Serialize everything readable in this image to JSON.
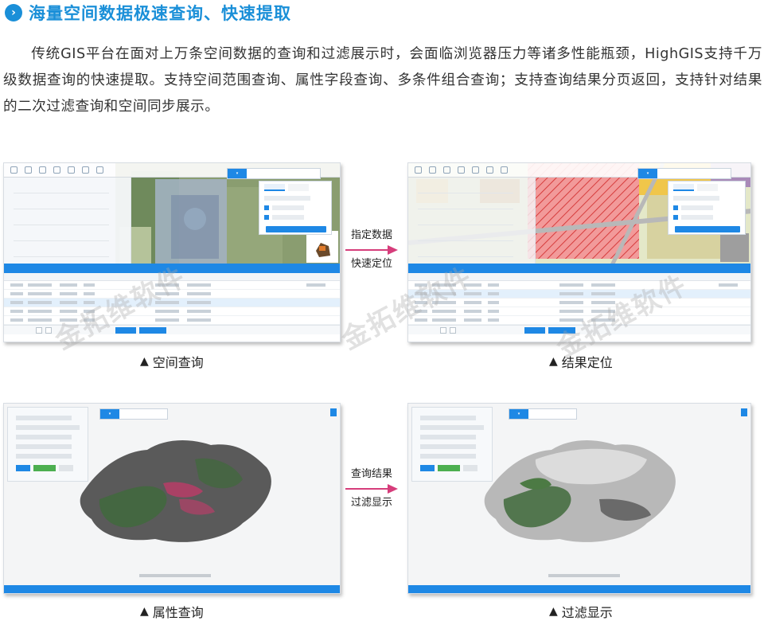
{
  "header": {
    "icon": "chevron-right-icon",
    "title": "海量空间数据极速查询、快速提取"
  },
  "intro": "传统GIS平台在面对上万条空间数据的查询和过滤展示时，会面临浏览器压力等诸多性能瓶颈，HighGIS支持千万级数据查询的快速提取。支持空间范围查询、属性字段查询、多条件组合查询；支持查询结果分页返回，支持针对结果的二次过滤查询和空间同步展示。",
  "arrows": {
    "top": {
      "line1": "指定数据",
      "line2": "快速定位"
    },
    "bottom": {
      "line1": "查询结果",
      "line2": "过滤显示"
    }
  },
  "captions": {
    "spatial_query": "空间查询",
    "result_locate": "结果定位",
    "attribute_query": "属性查询",
    "filter_display": "过滤显示",
    "marker": "▲"
  },
  "watermark": "金拓维软件",
  "colors": {
    "accent": "#1a8fd8",
    "arrow": "#d63d7b",
    "panel_blue": "#1e88e5"
  }
}
